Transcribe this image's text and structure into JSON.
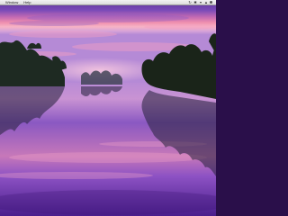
{
  "menubar": {
    "items": [
      {
        "label": "Window"
      },
      {
        "label": "Help"
      }
    ],
    "status_icons": [
      {
        "name": "sync-icon"
      },
      {
        "name": "bluetooth-icon"
      },
      {
        "name": "wifi-icon"
      },
      {
        "name": "volume-icon"
      },
      {
        "name": "battery-icon"
      }
    ],
    "clock": ""
  },
  "wallpaper": {
    "description_colors": {
      "sky_top": "#6a3fa8",
      "sky_glow": "#f08aa8",
      "horizon": "#f7b6c8",
      "water": "#8a4fc9",
      "trees": "#1c2418"
    }
  }
}
